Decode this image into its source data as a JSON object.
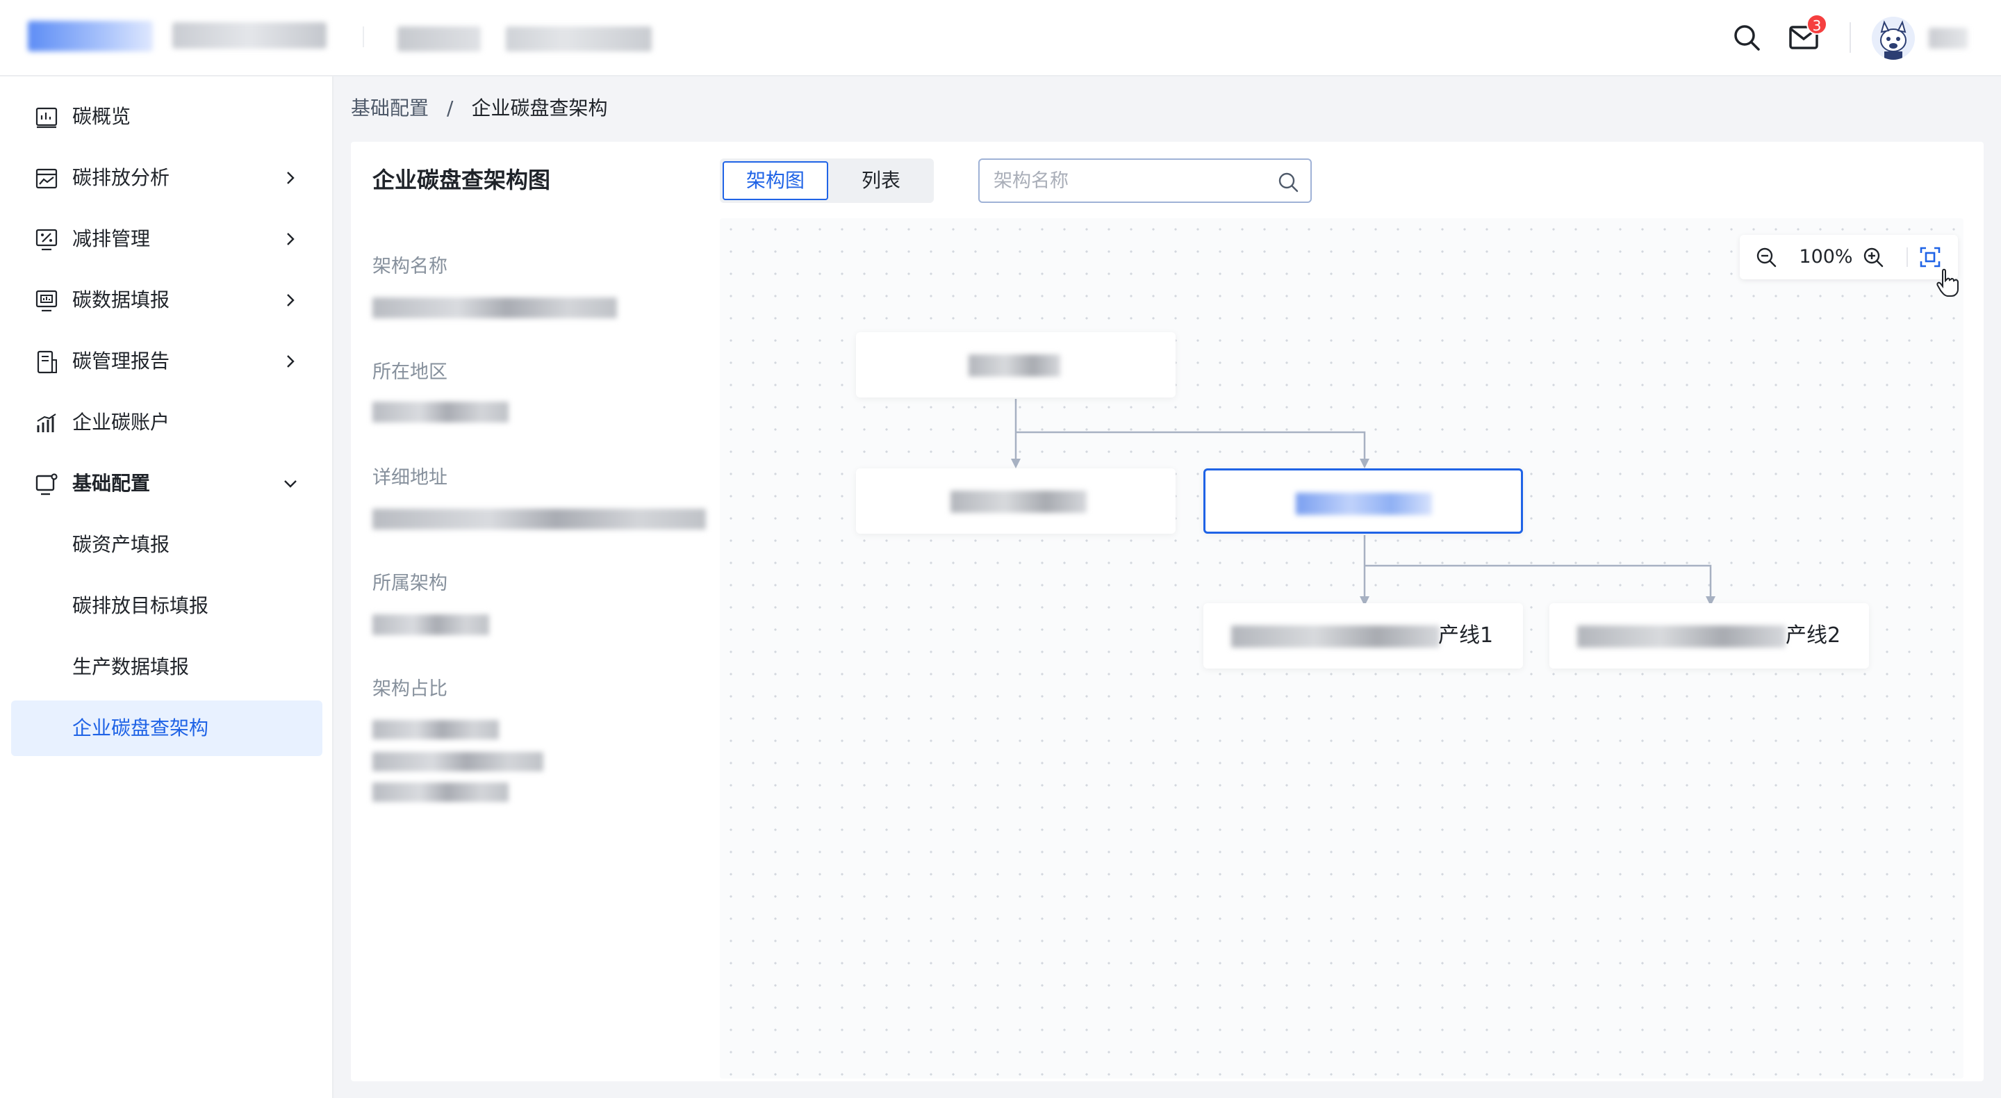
{
  "colors": {
    "accent": "#1f63e6",
    "active_bg": "#e8f1ff",
    "badge": "#f53f3f",
    "edge": "#a7b1c2"
  },
  "topbar": {
    "mail_badge": "3",
    "icons": [
      "search-icon",
      "mail-icon",
      "avatar"
    ]
  },
  "sidebar": {
    "items": [
      {
        "label": "碳概览",
        "icon": "dashboard-icon",
        "has_chevron": false
      },
      {
        "label": "碳排放分析",
        "icon": "chart-image-icon",
        "has_chevron": true
      },
      {
        "label": "减排管理",
        "icon": "percent-monitor-icon",
        "has_chevron": true
      },
      {
        "label": "碳数据填报",
        "icon": "data-monitor-icon",
        "has_chevron": true
      },
      {
        "label": "碳管理报告",
        "icon": "report-icon",
        "has_chevron": true
      },
      {
        "label": "企业碳账户",
        "icon": "bar-chart-icon",
        "has_chevron": false
      },
      {
        "label": "基础配置",
        "icon": "settings-monitor-icon",
        "has_chevron": true,
        "expanded": true
      }
    ],
    "subitems": [
      {
        "label": "碳资产填报"
      },
      {
        "label": "碳排放目标填报"
      },
      {
        "label": "生产数据填报"
      },
      {
        "label": "企业碳盘查架构",
        "active": true
      }
    ]
  },
  "breadcrumb": {
    "parent": "基础配置",
    "separator": "/",
    "current": "企业碳盘查架构"
  },
  "card": {
    "title": "企业碳盘查架构图",
    "tabs": {
      "chart": "架构图",
      "list": "列表"
    },
    "search": {
      "placeholder": "架构名称",
      "value": ""
    }
  },
  "detail": {
    "name_label": "架构名称",
    "region_label": "所在地区",
    "address_label": "详细地址",
    "parent_label": "所属架构",
    "ratio_label": "架构占比"
  },
  "zoom": {
    "value": "100%"
  },
  "nodes": {
    "line1_suffix": "产线1",
    "line2_suffix": "产线2"
  }
}
